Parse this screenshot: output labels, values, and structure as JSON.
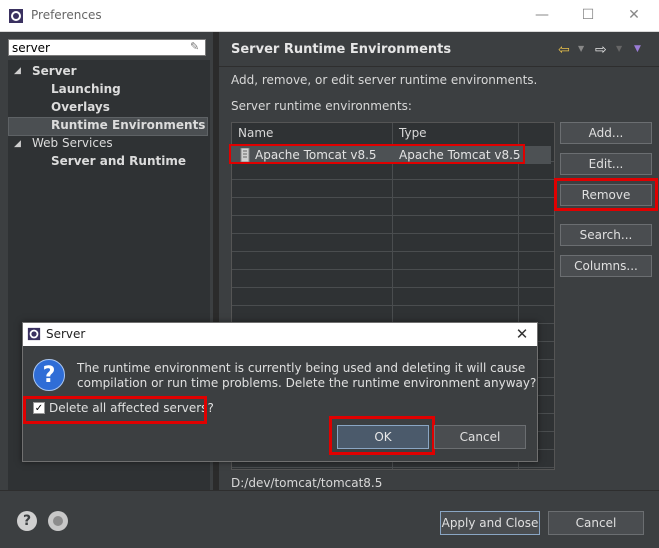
{
  "window": {
    "title": "Preferences",
    "minimize_icon": "minimize-icon",
    "maximize_icon": "maximize-icon",
    "close_icon": "close-icon"
  },
  "filter": {
    "value": "server",
    "clear_icon": "eraser-icon"
  },
  "tree": {
    "items": [
      {
        "label": "Server",
        "level": 0,
        "expanded": true
      },
      {
        "label": "Launching",
        "level": 1
      },
      {
        "label": "Overlays",
        "level": 1
      },
      {
        "label": "Runtime Environments",
        "level": 1,
        "selected": true
      },
      {
        "label": "Web Services",
        "level": 0,
        "expanded": true
      },
      {
        "label": "Server and Runtime",
        "level": 1
      }
    ]
  },
  "page": {
    "title": "Server Runtime Environments",
    "description": "Add, remove, or edit server runtime environments.",
    "list_label": "Server runtime environments:",
    "columns": [
      "Name",
      "Type"
    ],
    "rows": [
      {
        "name": "Apache Tomcat v8.5",
        "type": "Apache Tomcat v8.5"
      }
    ],
    "path": "D:/dev/tomcat/tomcat8.5"
  },
  "buttons": {
    "add": "Add...",
    "edit": "Edit...",
    "remove": "Remove",
    "search": "Search...",
    "columns": "Columns..."
  },
  "bottom": {
    "apply_close": "Apply and Close",
    "cancel": "Cancel"
  },
  "dialog": {
    "title": "Server",
    "message_line1": "The runtime environment is currently being used and deleting it will cause",
    "message_line2": "compilation or run time problems. Delete the runtime environment anyway?",
    "checkbox_label": "Delete all affected servers?",
    "checkbox_checked": true,
    "ok": "OK",
    "cancel": "Cancel"
  },
  "colors": {
    "highlight": "#e00000",
    "background": "#3c3f41",
    "question": "#2f6dd6"
  }
}
